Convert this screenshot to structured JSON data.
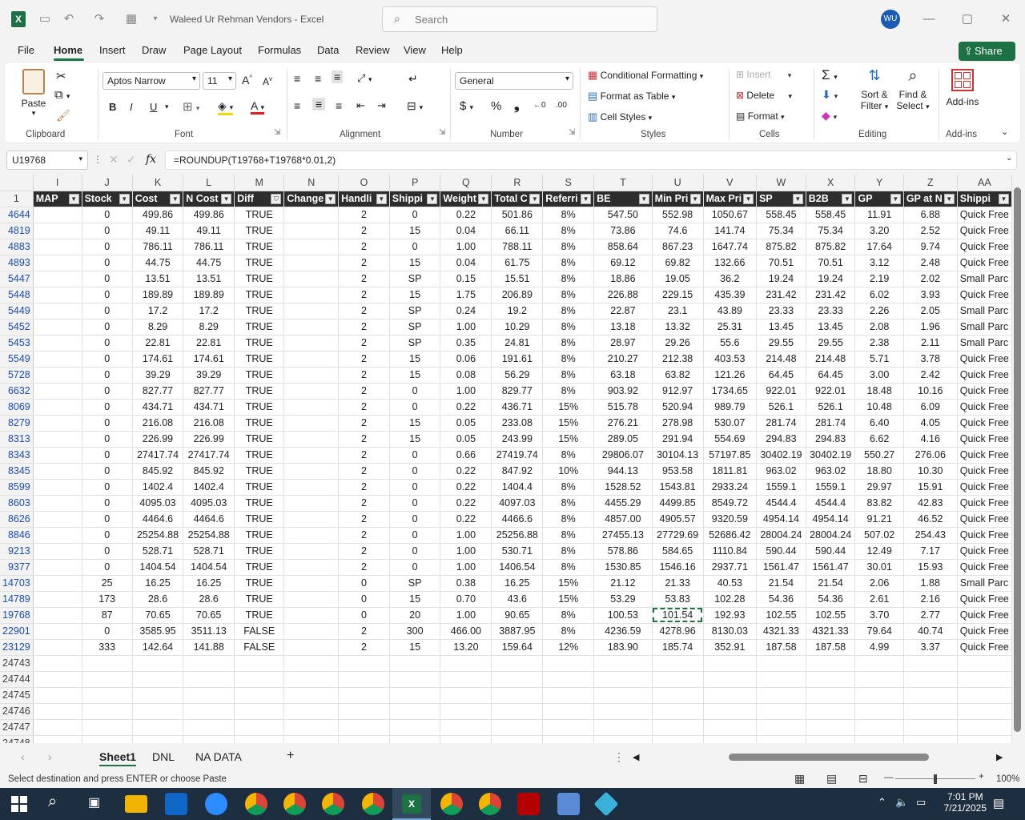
{
  "window": {
    "title": "Waleed Ur Rehman Vendors  -  Excel",
    "search_placeholder": "Search",
    "user_initials": "WU"
  },
  "menu": {
    "items": [
      "File",
      "Home",
      "Insert",
      "Draw",
      "Page Layout",
      "Formulas",
      "Data",
      "Review",
      "View",
      "Help"
    ],
    "share": "Share"
  },
  "ribbon": {
    "clipboard": {
      "label": "Clipboard",
      "paste": "Paste"
    },
    "font": {
      "label": "Font",
      "family": "Aptos Narrow",
      "size": "11",
      "bold": "B",
      "italic": "I",
      "underline": "U"
    },
    "alignment": {
      "label": "Alignment"
    },
    "number": {
      "label": "Number",
      "format": "General"
    },
    "styles": {
      "label": "Styles",
      "conditional": "Conditional Formatting",
      "table": "Format as Table",
      "cell": "Cell Styles"
    },
    "cells": {
      "label": "Cells",
      "insert": "Insert",
      "delete": "Delete",
      "format": "Format"
    },
    "editing": {
      "label": "Editing",
      "sort": "Sort &",
      "filter": "Filter",
      "find": "Find &",
      "select": "Select"
    },
    "addins": {
      "label": "Add-ins",
      "button": "Add-ins"
    }
  },
  "formula_bar": {
    "name_box": "U19768",
    "fx": "fx",
    "formula": "=ROUNDUP(T19768+T19768*0.01,2)"
  },
  "columns": [
    "I",
    "J",
    "K",
    "L",
    "M",
    "N",
    "O",
    "P",
    "Q",
    "R",
    "S",
    "T",
    "U",
    "V",
    "W",
    "X",
    "Y",
    "Z",
    "AA"
  ],
  "header_row_num": "1",
  "headers": [
    "MAP",
    "Stock",
    "Cost",
    "N Cost",
    "Diff",
    "Change",
    "Handli",
    "Shippi",
    "Weight",
    "Total C",
    "Referri",
    "BE",
    "Min Pri",
    "Max Pri",
    "SP",
    "B2B",
    "GP",
    "GP at N",
    "Shippi"
  ],
  "rows": [
    {
      "n": "4644",
      "v": [
        "",
        "0",
        "499.86",
        "499.86",
        "TRUE",
        "",
        "2",
        "0",
        "0.22",
        "501.86",
        "8%",
        "547.50",
        "552.98",
        "1050.67",
        "558.45",
        "558.45",
        "11.91",
        "6.88",
        "Quick Free"
      ]
    },
    {
      "n": "4819",
      "v": [
        "",
        "0",
        "49.11",
        "49.11",
        "TRUE",
        "",
        "2",
        "15",
        "0.04",
        "66.11",
        "8%",
        "73.86",
        "74.6",
        "141.74",
        "75.34",
        "75.34",
        "3.20",
        "2.52",
        "Quick Free"
      ]
    },
    {
      "n": "4883",
      "v": [
        "",
        "0",
        "786.11",
        "786.11",
        "TRUE",
        "",
        "2",
        "0",
        "1.00",
        "788.11",
        "8%",
        "858.64",
        "867.23",
        "1647.74",
        "875.82",
        "875.82",
        "17.64",
        "9.74",
        "Quick Free"
      ]
    },
    {
      "n": "4893",
      "v": [
        "",
        "0",
        "44.75",
        "44.75",
        "TRUE",
        "",
        "2",
        "15",
        "0.04",
        "61.75",
        "8%",
        "69.12",
        "69.82",
        "132.66",
        "70.51",
        "70.51",
        "3.12",
        "2.48",
        "Quick Free"
      ]
    },
    {
      "n": "5447",
      "v": [
        "",
        "0",
        "13.51",
        "13.51",
        "TRUE",
        "",
        "2",
        "SP",
        "0.15",
        "15.51",
        "8%",
        "18.86",
        "19.05",
        "36.2",
        "19.24",
        "19.24",
        "2.19",
        "2.02",
        "Small Parc"
      ]
    },
    {
      "n": "5448",
      "v": [
        "",
        "0",
        "189.89",
        "189.89",
        "TRUE",
        "",
        "2",
        "15",
        "1.75",
        "206.89",
        "8%",
        "226.88",
        "229.15",
        "435.39",
        "231.42",
        "231.42",
        "6.02",
        "3.93",
        "Quick Free"
      ]
    },
    {
      "n": "5449",
      "v": [
        "",
        "0",
        "17.2",
        "17.2",
        "TRUE",
        "",
        "2",
        "SP",
        "0.24",
        "19.2",
        "8%",
        "22.87",
        "23.1",
        "43.89",
        "23.33",
        "23.33",
        "2.26",
        "2.05",
        "Small Parc"
      ]
    },
    {
      "n": "5452",
      "v": [
        "",
        "0",
        "8.29",
        "8.29",
        "TRUE",
        "",
        "2",
        "SP",
        "1.00",
        "10.29",
        "8%",
        "13.18",
        "13.32",
        "25.31",
        "13.45",
        "13.45",
        "2.08",
        "1.96",
        "Small Parc"
      ]
    },
    {
      "n": "5453",
      "v": [
        "",
        "0",
        "22.81",
        "22.81",
        "TRUE",
        "",
        "2",
        "SP",
        "0.35",
        "24.81",
        "8%",
        "28.97",
        "29.26",
        "55.6",
        "29.55",
        "29.55",
        "2.38",
        "2.11",
        "Small Parc"
      ]
    },
    {
      "n": "5549",
      "v": [
        "",
        "0",
        "174.61",
        "174.61",
        "TRUE",
        "",
        "2",
        "15",
        "0.06",
        "191.61",
        "8%",
        "210.27",
        "212.38",
        "403.53",
        "214.48",
        "214.48",
        "5.71",
        "3.78",
        "Quick Free"
      ]
    },
    {
      "n": "5728",
      "v": [
        "",
        "0",
        "39.29",
        "39.29",
        "TRUE",
        "",
        "2",
        "15",
        "0.08",
        "56.29",
        "8%",
        "63.18",
        "63.82",
        "121.26",
        "64.45",
        "64.45",
        "3.00",
        "2.42",
        "Quick Free"
      ]
    },
    {
      "n": "6632",
      "v": [
        "",
        "0",
        "827.77",
        "827.77",
        "TRUE",
        "",
        "2",
        "0",
        "1.00",
        "829.77",
        "8%",
        "903.92",
        "912.97",
        "1734.65",
        "922.01",
        "922.01",
        "18.48",
        "10.16",
        "Quick Free"
      ]
    },
    {
      "n": "8069",
      "v": [
        "",
        "0",
        "434.71",
        "434.71",
        "TRUE",
        "",
        "2",
        "0",
        "0.22",
        "436.71",
        "15%",
        "515.78",
        "520.94",
        "989.79",
        "526.1",
        "526.1",
        "10.48",
        "6.09",
        "Quick Free"
      ]
    },
    {
      "n": "8279",
      "v": [
        "",
        "0",
        "216.08",
        "216.08",
        "TRUE",
        "",
        "2",
        "15",
        "0.05",
        "233.08",
        "15%",
        "276.21",
        "278.98",
        "530.07",
        "281.74",
        "281.74",
        "6.40",
        "4.05",
        "Quick Free"
      ]
    },
    {
      "n": "8313",
      "v": [
        "",
        "0",
        "226.99",
        "226.99",
        "TRUE",
        "",
        "2",
        "15",
        "0.05",
        "243.99",
        "15%",
        "289.05",
        "291.94",
        "554.69",
        "294.83",
        "294.83",
        "6.62",
        "4.16",
        "Quick Free"
      ]
    },
    {
      "n": "8343",
      "v": [
        "",
        "0",
        "27417.74",
        "27417.74",
        "TRUE",
        "",
        "2",
        "0",
        "0.66",
        "27419.74",
        "8%",
        "29806.07",
        "30104.13",
        "57197.85",
        "30402.19",
        "30402.19",
        "550.27",
        "276.06",
        "Quick Free"
      ]
    },
    {
      "n": "8345",
      "v": [
        "",
        "0",
        "845.92",
        "845.92",
        "TRUE",
        "",
        "2",
        "0",
        "0.22",
        "847.92",
        "10%",
        "944.13",
        "953.58",
        "1811.81",
        "963.02",
        "963.02",
        "18.80",
        "10.30",
        "Quick Free"
      ]
    },
    {
      "n": "8599",
      "v": [
        "",
        "0",
        "1402.4",
        "1402.4",
        "TRUE",
        "",
        "2",
        "0",
        "0.22",
        "1404.4",
        "8%",
        "1528.52",
        "1543.81",
        "2933.24",
        "1559.1",
        "1559.1",
        "29.97",
        "15.91",
        "Quick Free"
      ]
    },
    {
      "n": "8603",
      "v": [
        "",
        "0",
        "4095.03",
        "4095.03",
        "TRUE",
        "",
        "2",
        "0",
        "0.22",
        "4097.03",
        "8%",
        "4455.29",
        "4499.85",
        "8549.72",
        "4544.4",
        "4544.4",
        "83.82",
        "42.83",
        "Quick Free"
      ]
    },
    {
      "n": "8626",
      "v": [
        "",
        "0",
        "4464.6",
        "4464.6",
        "TRUE",
        "",
        "2",
        "0",
        "0.22",
        "4466.6",
        "8%",
        "4857.00",
        "4905.57",
        "9320.59",
        "4954.14",
        "4954.14",
        "91.21",
        "46.52",
        "Quick Free"
      ]
    },
    {
      "n": "8846",
      "v": [
        "",
        "0",
        "25254.88",
        "25254.88",
        "TRUE",
        "",
        "2",
        "0",
        "1.00",
        "25256.88",
        "8%",
        "27455.13",
        "27729.69",
        "52686.42",
        "28004.24",
        "28004.24",
        "507.02",
        "254.43",
        "Quick Free"
      ]
    },
    {
      "n": "9213",
      "v": [
        "",
        "0",
        "528.71",
        "528.71",
        "TRUE",
        "",
        "2",
        "0",
        "1.00",
        "530.71",
        "8%",
        "578.86",
        "584.65",
        "1110.84",
        "590.44",
        "590.44",
        "12.49",
        "7.17",
        "Quick Free"
      ]
    },
    {
      "n": "9377",
      "v": [
        "",
        "0",
        "1404.54",
        "1404.54",
        "TRUE",
        "",
        "2",
        "0",
        "1.00",
        "1406.54",
        "8%",
        "1530.85",
        "1546.16",
        "2937.71",
        "1561.47",
        "1561.47",
        "30.01",
        "15.93",
        "Quick Free"
      ]
    },
    {
      "n": "14703",
      "v": [
        "",
        "25",
        "16.25",
        "16.25",
        "TRUE",
        "",
        "0",
        "SP",
        "0.38",
        "16.25",
        "15%",
        "21.12",
        "21.33",
        "40.53",
        "21.54",
        "21.54",
        "2.06",
        "1.88",
        "Small Parc"
      ]
    },
    {
      "n": "14789",
      "v": [
        "",
        "173",
        "28.6",
        "28.6",
        "TRUE",
        "",
        "0",
        "15",
        "0.70",
        "43.6",
        "15%",
        "53.29",
        "53.83",
        "102.28",
        "54.36",
        "54.36",
        "2.61",
        "2.16",
        "Quick Free"
      ]
    },
    {
      "n": "19768",
      "v": [
        "",
        "87",
        "70.65",
        "70.65",
        "TRUE",
        "",
        "0",
        "20",
        "1.00",
        "90.65",
        "8%",
        "100.53",
        "101.54",
        "192.93",
        "102.55",
        "102.55",
        "3.70",
        "2.77",
        "Quick Free"
      ]
    },
    {
      "n": "22901",
      "v": [
        "",
        "0",
        "3585.95",
        "3511.13",
        "FALSE",
        "",
        "2",
        "300",
        "466.00",
        "3887.95",
        "8%",
        "4236.59",
        "4278.96",
        "8130.03",
        "4321.33",
        "4321.33",
        "79.64",
        "40.74",
        "Quick Free"
      ]
    },
    {
      "n": "23129",
      "v": [
        "",
        "333",
        "142.64",
        "141.88",
        "FALSE",
        "",
        "2",
        "15",
        "13.20",
        "159.64",
        "12%",
        "183.90",
        "185.74",
        "352.91",
        "187.58",
        "187.58",
        "4.99",
        "3.37",
        "Quick Free"
      ]
    },
    {
      "n": "24743",
      "v": [
        "",
        "",
        "",
        "",
        "",
        "",
        "",
        "",
        "",
        "",
        "",
        "",
        "",
        "",
        "",
        "",
        "",
        "",
        ""
      ]
    },
    {
      "n": "24744",
      "v": [
        "",
        "",
        "",
        "",
        "",
        "",
        "",
        "",
        "",
        "",
        "",
        "",
        "",
        "",
        "",
        "",
        "",
        "",
        ""
      ]
    },
    {
      "n": "24745",
      "v": [
        "",
        "",
        "",
        "",
        "",
        "",
        "",
        "",
        "",
        "",
        "",
        "",
        "",
        "",
        "",
        "",
        "",
        "",
        ""
      ]
    },
    {
      "n": "24746",
      "v": [
        "",
        "",
        "",
        "",
        "",
        "",
        "",
        "",
        "",
        "",
        "",
        "",
        "",
        "",
        "",
        "",
        "",
        "",
        ""
      ]
    },
    {
      "n": "24747",
      "v": [
        "",
        "",
        "",
        "",
        "",
        "",
        "",
        "",
        "",
        "",
        "",
        "",
        "",
        "",
        "",
        "",
        "",
        "",
        ""
      ]
    },
    {
      "n": "24748",
      "v": [
        "",
        "",
        "",
        "",
        "",
        "",
        "",
        "",
        "",
        "",
        "",
        "",
        "",
        "",
        "",
        "",
        "",
        "",
        ""
      ]
    }
  ],
  "sheets": [
    "Sheet1",
    "DNL",
    "NA DATA"
  ],
  "status": {
    "message": "Select destination and press ENTER or choose Paste",
    "zoom": "100%"
  },
  "taskbar": {
    "time": "7:01 PM",
    "date": "7/21/2025"
  },
  "colors": {
    "excel_green": "#1e7145",
    "header_fill": "#2d2d2d",
    "row_number_blue": "#1a4db8"
  }
}
